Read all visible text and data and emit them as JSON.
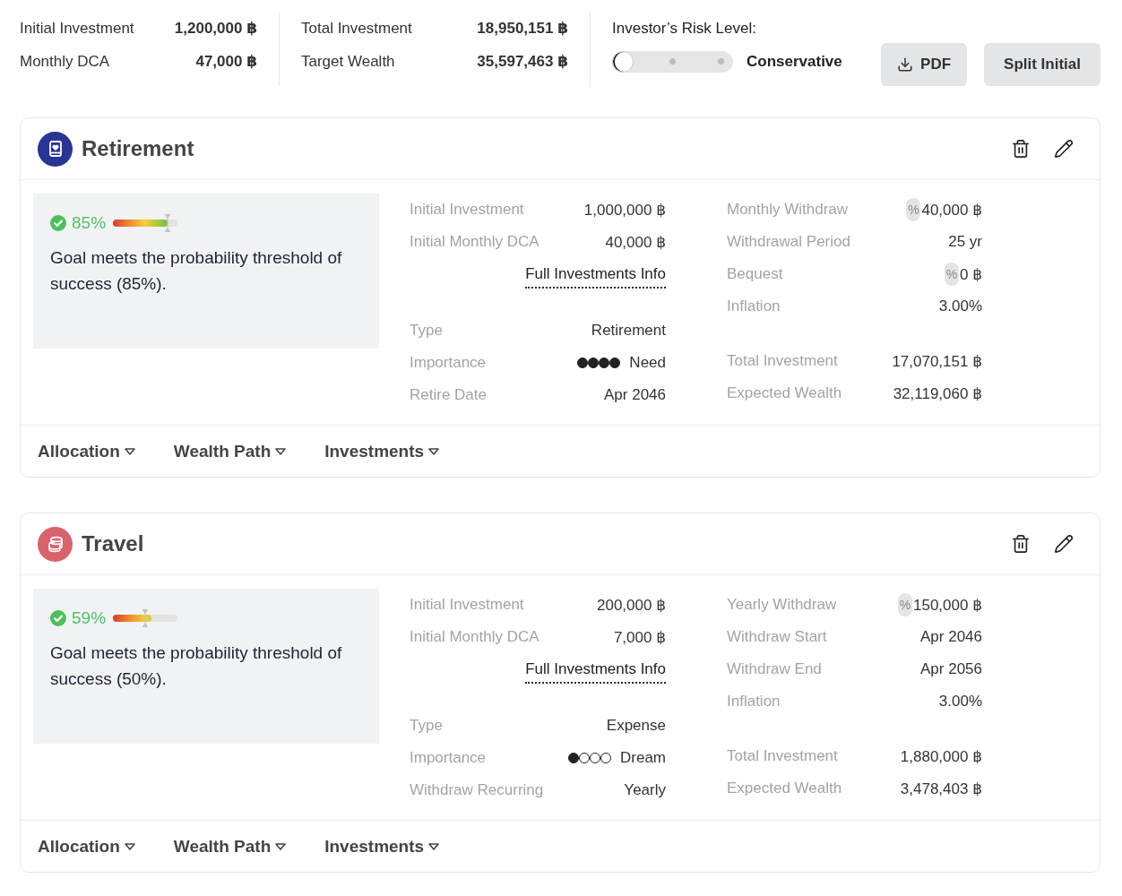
{
  "summary": {
    "groups": [
      [
        {
          "label": "Initial Investment",
          "value": "1,200,000 ฿"
        },
        {
          "label": "Monthly DCA",
          "value": "47,000 ฿"
        }
      ],
      [
        {
          "label": "Total Investment",
          "value": "18,950,151 ฿"
        },
        {
          "label": "Target Wealth",
          "value": "35,597,463 ฿"
        }
      ]
    ]
  },
  "risk": {
    "label": "Investor’s Risk Level:",
    "level": 0,
    "value": "Conservative"
  },
  "actions": [
    {
      "kind": "download",
      "label": "PDF"
    },
    {
      "kind": "plain",
      "label": "Split Initial"
    }
  ],
  "goals": [
    {
      "kind": "retirement",
      "color": "#283593",
      "title": "Retirement",
      "probability": {
        "value": "85%",
        "level": 0.85,
        "threshold": {
          "level": 0.85
        }
      },
      "message": "Goal meets the probability threshold of success (85%).",
      "investments": [
        {
          "label": "Initial Investment",
          "value": "1,000,000 ฿"
        },
        {
          "label": "Initial Monthly DCA",
          "value": "40,000 ฿"
        }
      ],
      "link": "Full Investments Info",
      "info": [
        {
          "kind": "text",
          "label": "Type",
          "value": "Retirement"
        },
        {
          "kind": "importance",
          "label": "Importance",
          "stars": 4,
          "value": "Need"
        },
        {
          "kind": "text",
          "label": "Retire Date",
          "value": "Apr 2046"
        }
      ],
      "withdrawal": [
        {
          "label": "Monthly Withdraw",
          "toggle": "%",
          "value": "40,000 ฿"
        },
        {
          "label": "Withdrawal Period",
          "value": "25 yr"
        },
        {
          "label": "Bequest",
          "toggle": "%",
          "value": "0 ฿"
        },
        {
          "label": "Inflation",
          "value": "3.00%"
        }
      ],
      "totals": [
        {
          "label": "Total Investment",
          "value": "17,070,151 ฿"
        },
        {
          "label": "Expected Wealth",
          "value": "32,119,060 ฿"
        }
      ],
      "sections": [
        "Allocation",
        "Wealth Path",
        "Investments"
      ]
    },
    {
      "kind": "expense",
      "color": "#d9636d",
      "title": "Travel",
      "probability": {
        "value": "59%",
        "level": 0.59,
        "threshold": {
          "level": 0.5
        }
      },
      "message": "Goal meets the probability threshold of success (50%).",
      "investments": [
        {
          "label": "Initial Investment",
          "value": "200,000 ฿"
        },
        {
          "label": "Initial Monthly DCA",
          "value": "7,000 ฿"
        }
      ],
      "link": "Full Investments Info",
      "info": [
        {
          "kind": "text",
          "label": "Type",
          "value": "Expense"
        },
        {
          "kind": "importance",
          "label": "Importance",
          "stars": 1,
          "value": "Dream"
        },
        {
          "kind": "text",
          "label": "Withdraw Recurring",
          "value": "Yearly"
        }
      ],
      "withdrawal": [
        {
          "label": "Yearly Withdraw",
          "toggle": "%",
          "value": "150,000 ฿"
        },
        {
          "label": "Withdraw Start",
          "value": "Apr 2046"
        },
        {
          "label": "Withdraw End",
          "value": "Apr 2056"
        },
        {
          "label": "Inflation",
          "value": "3.00%"
        }
      ],
      "totals": [
        {
          "label": "Total Investment",
          "value": "1,880,000 ฿"
        },
        {
          "label": "Expected Wealth",
          "value": "3,478,403 ฿"
        }
      ],
      "sections": [
        "Allocation",
        "Wealth Path",
        "Investments"
      ]
    }
  ]
}
